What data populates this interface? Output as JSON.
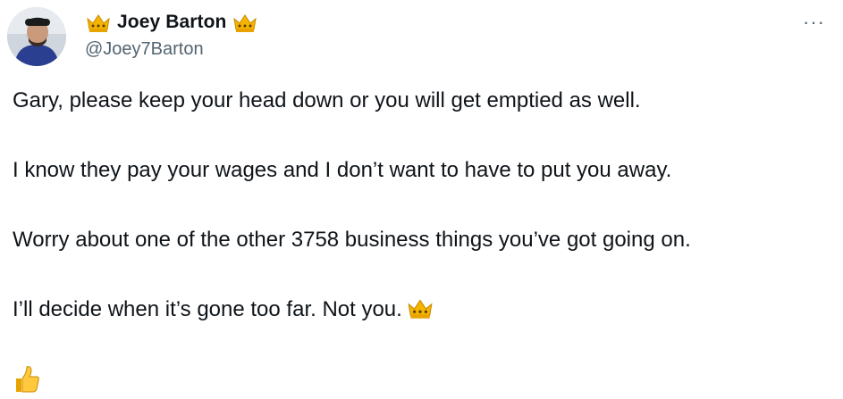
{
  "author": {
    "display_name": "Joey Barton",
    "handle": "@Joey7Barton",
    "name_emoji": "crown-emoji",
    "avatar_icon": "profile-photo"
  },
  "menu": {
    "more_label": "···",
    "icon": "more-horizontal-icon"
  },
  "tweet": {
    "paragraphs": [
      "Gary, please keep your head down or you will get emptied as well.",
      "I know they pay your wages and I don’t want to have to put you away.",
      "Worry about one of the other 3758 business things you’ve got going on.",
      "I’ll decide when it’s gone too far. Not you."
    ],
    "trailing_emoji": "crown-emoji",
    "final_emoji": "thumbs-up-emoji"
  },
  "colors": {
    "text": "#0f1419",
    "secondary": "#536471",
    "crown": "#f4b400",
    "thumb": "#ffc83d"
  }
}
